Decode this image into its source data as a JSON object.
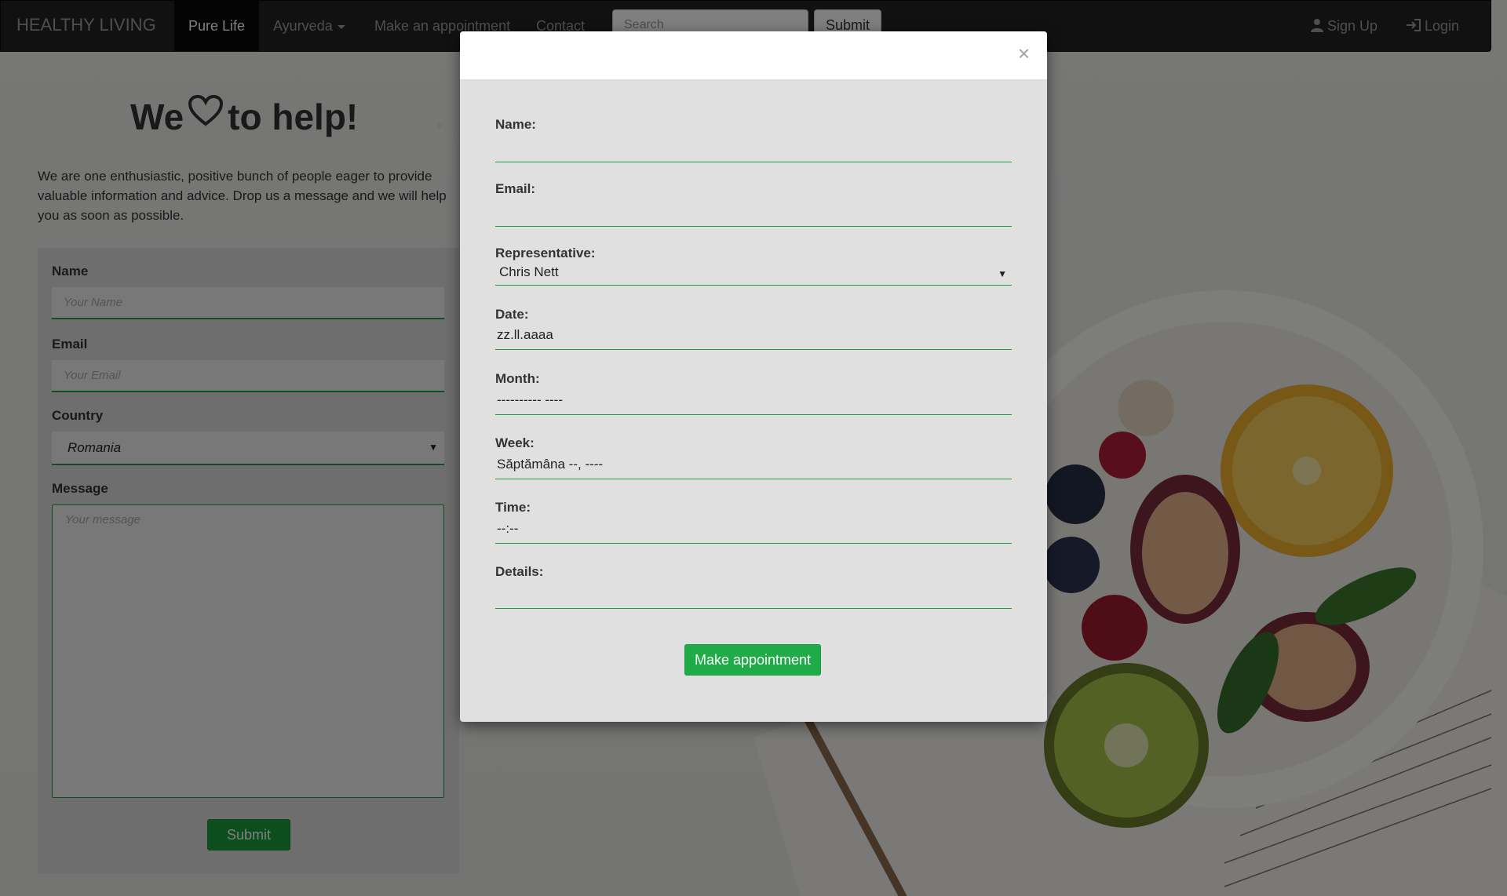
{
  "navbar": {
    "brand": "HEALTHY LIVING",
    "items": [
      {
        "label": "Pure Life",
        "active": true
      },
      {
        "label": "Ayurveda",
        "dropdown": true
      },
      {
        "label": "Make an appointment"
      },
      {
        "label": "Contact"
      }
    ],
    "search_placeholder": "Search",
    "search_button": "Submit",
    "signup": {
      "label": "Sign Up",
      "icon": "user-icon"
    },
    "login": {
      "label": "Login",
      "icon": "login-icon"
    }
  },
  "hero": {
    "title_pre": "We",
    "title_post": "to help!",
    "title_icon": "heart-icon",
    "intro": "We are one enthusiastic, positive bunch of people eager to provide valuable information and advice. Drop us a message and we will help you as soon as possible."
  },
  "contact_form": {
    "name_label": "Name",
    "name_placeholder": "Your Name",
    "email_label": "Email",
    "email_placeholder": "Your Email",
    "country_label": "Country",
    "country_value": "Romania",
    "message_label": "Message",
    "message_placeholder": "Your message",
    "submit_label": "Submit"
  },
  "modal": {
    "close_symbol": "×",
    "name_label": "Name:",
    "email_label": "Email:",
    "representative_label": "Representative:",
    "representative_value": "Chris Nett",
    "date_label": "Date:",
    "date_value": "zz.ll.aaaa",
    "month_label": "Month:",
    "month_value": "---------- ----",
    "week_label": "Week:",
    "week_value": "Săptămâna --, ----",
    "time_label": "Time:",
    "time_value": "--:--",
    "details_label": "Details:",
    "submit_label": "Make appointment"
  },
  "colors": {
    "accent_green": "#1fac48",
    "navbar_bg": "#222222",
    "overlay": "rgba(0,0,0,0.5)"
  }
}
